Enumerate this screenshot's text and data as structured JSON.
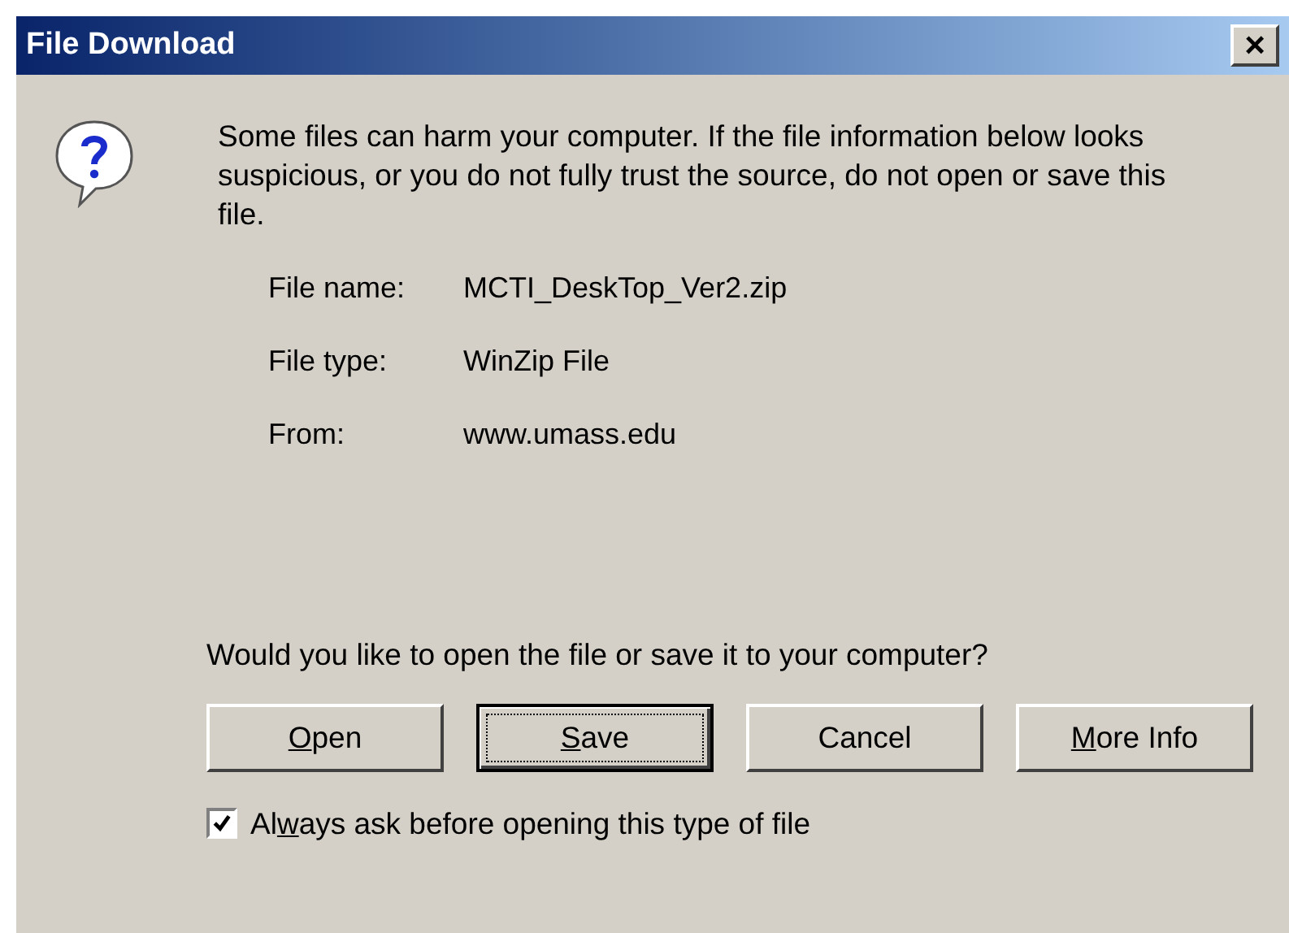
{
  "window": {
    "title": "File Download",
    "close": "×"
  },
  "message": "Some files can harm your computer. If the file information below looks suspicious, or you do not fully trust the source, do not open or save this file.",
  "file_info": [
    {
      "label": "File name:",
      "value": "MCTI_DeskTop_Ver2.zip"
    },
    {
      "label": "File type:",
      "value": "WinZip File"
    },
    {
      "label": "From:",
      "value": "www.umass.edu"
    }
  ],
  "question": "Would you like to open the file or save it to your computer?",
  "buttons": [
    {
      "parts": [
        {
          "text": "O",
          "underline": true
        },
        {
          "text": "pen",
          "underline": false
        }
      ],
      "default": false
    },
    {
      "parts": [
        {
          "text": "S",
          "underline": true
        },
        {
          "text": "ave",
          "underline": false
        }
      ],
      "default": true
    },
    {
      "parts": [
        {
          "text": "Cancel",
          "underline": false
        }
      ],
      "default": false
    },
    {
      "parts": [
        {
          "text": "M",
          "underline": true
        },
        {
          "text": "ore Info",
          "underline": false
        }
      ],
      "default": false
    }
  ],
  "checkbox": {
    "parts": [
      {
        "text": "Al",
        "underline": false
      },
      {
        "text": "w",
        "underline": true
      },
      {
        "text": "ays ask before opening this type of file",
        "underline": false
      }
    ],
    "checked": true
  }
}
